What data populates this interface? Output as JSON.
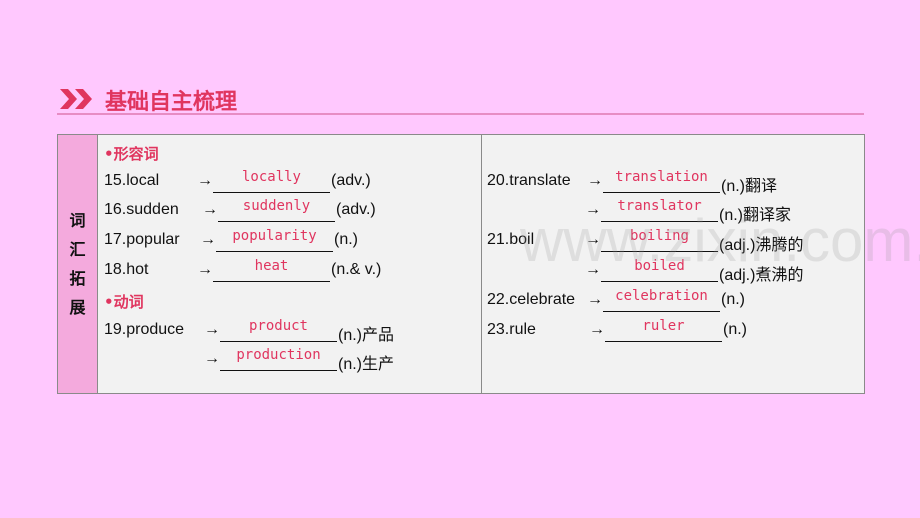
{
  "header": {
    "title": "基础自主梳理",
    "icon": "double-chevron-right-icon",
    "accent": "#e0355f"
  },
  "side_label": [
    "词",
    "汇",
    "拓",
    "展"
  ],
  "left": {
    "heading_adj": "•形容词",
    "heading_verb": "•动词",
    "rows": [
      {
        "label": "15.local",
        "arrow": "→",
        "answer": "locally",
        "suffix": "(adv.)"
      },
      {
        "label": "16.sudden",
        "arrow": "→",
        "answer": "suddenly",
        "suffix": "(adv.)"
      },
      {
        "label": "17.popular",
        "arrow": "→",
        "answer": "popularity",
        "suffix": "(n.)"
      },
      {
        "label": "18.hot",
        "arrow": "→",
        "answer": "heat",
        "suffix": "(n.& v.)"
      },
      {
        "label": "19.produce",
        "arrow": "→",
        "answer": "product",
        "suffix": "(n.)产品"
      },
      {
        "label": "",
        "arrow": "→",
        "answer": "production",
        "suffix": "(n.)生产"
      }
    ]
  },
  "right": {
    "rows": [
      {
        "label": "20.translate",
        "arrow": "→",
        "answer": "translation",
        "suffix": "(n.)翻译"
      },
      {
        "label": "",
        "arrow": "→",
        "answer": "translator",
        "suffix": "(n.)翻译家"
      },
      {
        "label": "21.boil",
        "arrow": "→",
        "answer": "boiling",
        "suffix": "(adj.)沸腾的"
      },
      {
        "label": "",
        "arrow": "→",
        "answer": "boiled",
        "suffix": "(adj.)煮沸的"
      },
      {
        "label": "22.celebrate",
        "arrow": "→",
        "answer": "celebration",
        "suffix": "(n.)"
      },
      {
        "label": "23.rule",
        "arrow": "→",
        "answer": "ruler",
        "suffix": "(n.)"
      }
    ]
  },
  "watermark": "www.zixin.com.cn"
}
